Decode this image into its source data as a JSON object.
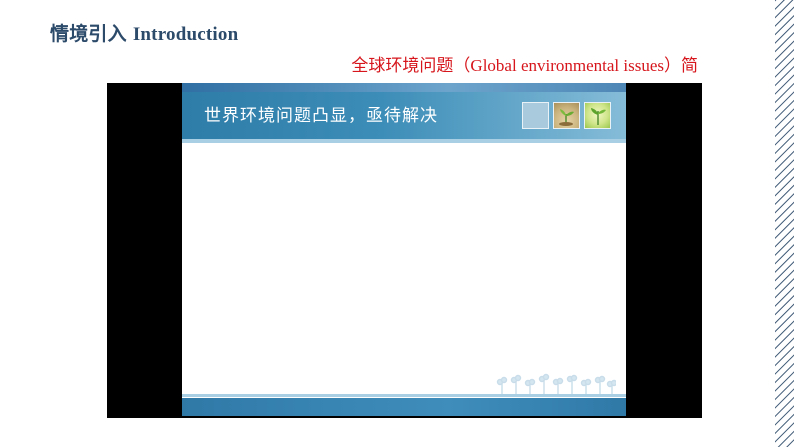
{
  "header": {
    "title_cn": "情境引入",
    "title_en": "Introduction"
  },
  "subtitle": "全球环境问题（Global environmental issues）简",
  "slide": {
    "heading": "世界环境问题凸显，亟待解决"
  },
  "colors": {
    "title": "#2c4a6a",
    "subtitle": "#d6161c",
    "banner": "#2e7ca8",
    "video_background": "#000000"
  },
  "icons": {
    "thumbnail_1": "blank-thumbnail",
    "thumbnail_2": "seedling-icon",
    "thumbnail_3": "leaves-icon",
    "footer_decoration": "plant-silhouette-icon"
  }
}
